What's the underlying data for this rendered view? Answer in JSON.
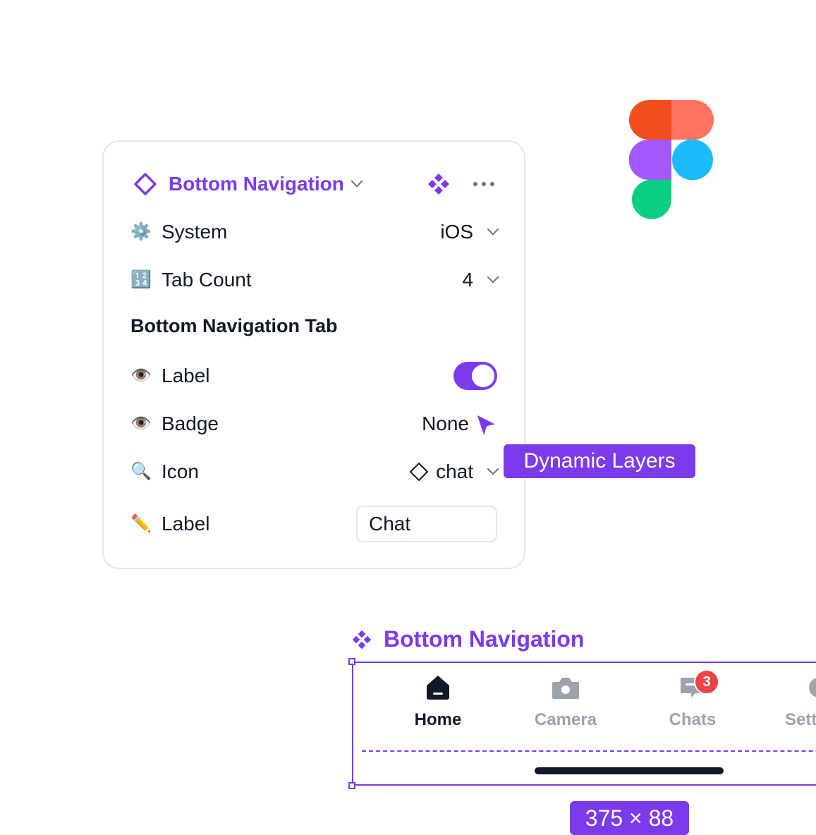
{
  "panel": {
    "component_name": "Bottom Navigation",
    "rows": [
      {
        "icon": "gear-icon",
        "emoji": "⚙️",
        "label": "System",
        "value": "iOS"
      },
      {
        "icon": "numbers-icon",
        "emoji": "🔢",
        "label": "Tab Count",
        "value": "4"
      }
    ],
    "section_title": "Bottom Navigation Tab",
    "tab_rows": [
      {
        "icon": "eye-icon",
        "emoji": "👁️",
        "label": "Label",
        "toggle_on": true
      },
      {
        "icon": "eye-icon",
        "emoji": "👁️",
        "label": "Badge",
        "value": "None"
      },
      {
        "icon": "magnifier-icon",
        "emoji": "🔍",
        "label": "Icon",
        "value": "chat"
      },
      {
        "icon": "pencil-icon",
        "emoji": "✏️",
        "label": "Label",
        "input_value": "Chat"
      }
    ]
  },
  "tooltip": "Dynamic Layers",
  "preview": {
    "title": "Bottom Navigation",
    "tabs": [
      {
        "label": "Home",
        "icon": "home-icon",
        "active": true
      },
      {
        "label": "Camera",
        "icon": "camera-icon",
        "active": false
      },
      {
        "label": "Chats",
        "icon": "chat-icon",
        "active": false,
        "badge": "3"
      },
      {
        "label": "Sett",
        "icon": "settings-icon",
        "active": false
      }
    ],
    "size": "375 × 88"
  },
  "colors": {
    "accent": "#7c3aed",
    "badge": "#ef4444",
    "inactive": "#9ca3af",
    "dark": "#111827"
  }
}
